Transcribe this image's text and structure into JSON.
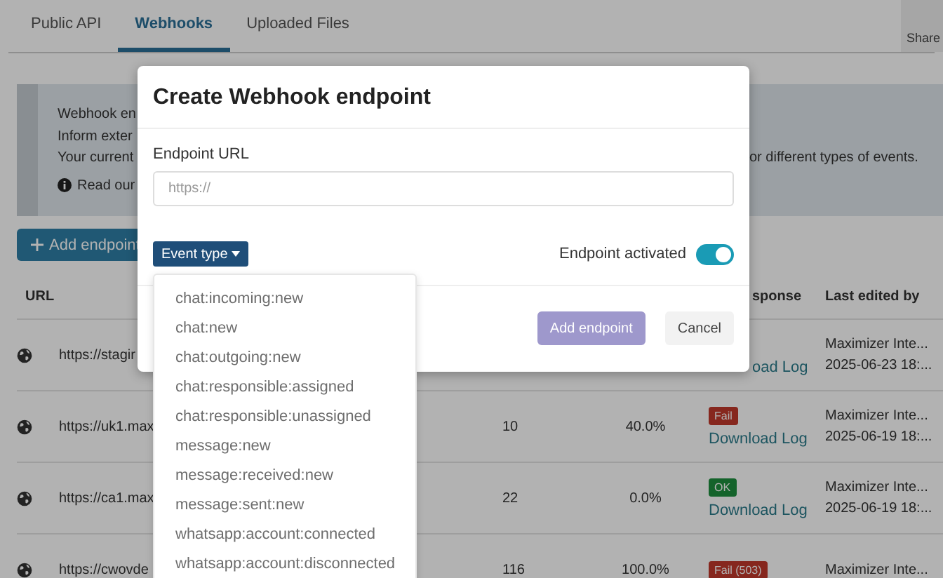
{
  "tabs": [
    {
      "label": "Public API",
      "selected": false
    },
    {
      "label": "Webhooks",
      "selected": true
    },
    {
      "label": "Uploaded Files",
      "selected": false
    }
  ],
  "share_button": "Share",
  "info": {
    "lines": [
      "Webhook en",
      "Inform exter",
      "Your current"
    ],
    "line_tail": "or different types of events.",
    "link_line": "Read our"
  },
  "add_button": "Add endpoint",
  "table": {
    "columns": [
      "URL",
      "sponse",
      "Last edited by"
    ],
    "rows": [
      {
        "url": "https://stagir",
        "count": "",
        "rate": "",
        "log": "oad Log",
        "editor": "Maximizer Inte...",
        "date": "2025-06-23 18:..."
      },
      {
        "url": "https://uk1.max",
        "count": "10",
        "rate": "40.0%",
        "status": {
          "kind": "fail",
          "text": "Fail"
        },
        "log": "Download Log",
        "editor": "Maximizer Inte...",
        "date": "2025-06-19 18:..."
      },
      {
        "url": "https://ca1.max",
        "count": "22",
        "rate": "0.0%",
        "status": {
          "kind": "ok",
          "text": "OK"
        },
        "log": "Download Log",
        "editor": "Maximizer Inte...",
        "date": "2025-06-19 18:..."
      },
      {
        "url": "https://cwovde",
        "count": "116",
        "rate": "100.0%",
        "status": {
          "kind": "fail",
          "text": "Fail (503)"
        },
        "editor": "Maximizer Inte..."
      }
    ]
  },
  "dialog": {
    "title": "Create Webhook endpoint",
    "url_label": "Endpoint URL",
    "url_placeholder": "https://",
    "event_button": "Event type",
    "activated_label": "Endpoint activated",
    "activated": true,
    "buttons": [
      {
        "label": "Add endpoint",
        "kind": "primary",
        "disabled": true
      },
      {
        "label": "Cancel",
        "kind": "secondary",
        "disabled": false
      }
    ]
  },
  "event_menu": [
    "chat:incoming:new",
    "chat:new",
    "chat:outgoing:new",
    "chat:responsible:assigned",
    "chat:responsible:unassigned",
    "message:new",
    "message:received:new",
    "message:sent:new",
    "whatsapp:account:connected",
    "whatsapp:account:disconnected"
  ]
}
